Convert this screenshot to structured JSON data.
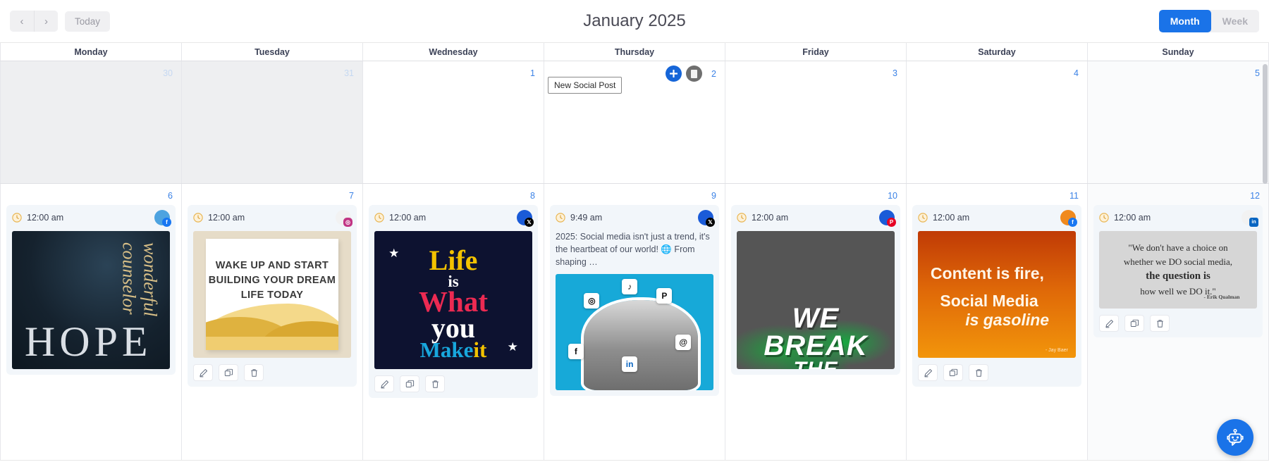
{
  "toolbar": {
    "prev_label": "‹",
    "next_label": "›",
    "today_label": "Today",
    "title": "January 2025",
    "month_label": "Month",
    "week_label": "Week"
  },
  "weekdays": [
    "Monday",
    "Tuesday",
    "Wednesday",
    "Thursday",
    "Friday",
    "Saturday",
    "Sunday"
  ],
  "tooltip": {
    "text": "New Social Post"
  },
  "colors": {
    "accent": "#1a73e8",
    "daynum": "#3b82e6",
    "daynum_muted": "#c5d8f2",
    "event_bg": "#f2f6fa",
    "other_month_bg": "#eeeff1"
  },
  "week1": [
    {
      "daynum": "30",
      "muted": true,
      "other_month": true
    },
    {
      "daynum": "31",
      "muted": true,
      "other_month": true
    },
    {
      "daynum": "1",
      "muted": false,
      "other_month": false
    },
    {
      "daynum": "2",
      "muted": false,
      "other_month": false,
      "hover": true
    },
    {
      "daynum": "3",
      "muted": false,
      "other_month": false
    },
    {
      "daynum": "4",
      "muted": false,
      "other_month": false
    },
    {
      "daynum": "5",
      "muted": false,
      "other_month": false,
      "weekend": true
    }
  ],
  "week2": [
    {
      "daynum": "6",
      "time": "12:00 am",
      "platform": "facebook",
      "avatar_color": "#4da3e0",
      "badge_glyph": "f",
      "badge_color": "#1877f2",
      "text": "",
      "art": "hope",
      "art_title": "HOPE",
      "art_script": "wonderful counselor",
      "show_actions": false
    },
    {
      "daynum": "7",
      "time": "12:00 am",
      "platform": "instagram",
      "avatar_color": "#f2f2f2",
      "badge_glyph": "◎",
      "badge_color": "#c13584",
      "text": "",
      "art": "wake",
      "art_text": "WAKE UP AND START BUILDING YOUR DREAM LIFE TODAY",
      "show_actions": true
    },
    {
      "daynum": "8",
      "time": "12:00 am",
      "platform": "twitter-x",
      "avatar_color": "#1a5bd8",
      "badge_glyph": "𝕏",
      "badge_color": "#000000",
      "text": "",
      "art": "life",
      "art_lines": [
        "Life",
        "is",
        "What",
        "you",
        "Make",
        "it"
      ],
      "show_actions": true
    },
    {
      "daynum": "9",
      "time": "9:49 am",
      "platform": "twitter-x",
      "avatar_color": "#1a5bd8",
      "badge_glyph": "𝕏",
      "badge_color": "#000000",
      "text": "2025: Social media isn't just a trend, it's the heartbeat of our world! 🌐 From shaping …",
      "art": "social",
      "art_icons": [
        "TikTok",
        "Pinterest",
        "Instagram",
        "Threads",
        "Facebook",
        "LinkedIn"
      ],
      "show_actions": false
    },
    {
      "daynum": "10",
      "time": "12:00 am",
      "platform": "pinterest",
      "avatar_color": "#1a5bd8",
      "badge_glyph": "P",
      "badge_color": "#e60023",
      "text": "",
      "art": "break",
      "art_lines": [
        "WE",
        "BREAK",
        "THE"
      ],
      "show_actions": false
    },
    {
      "daynum": "11",
      "time": "12:00 am",
      "platform": "facebook",
      "avatar_color": "#f08a1e",
      "badge_glyph": "f",
      "badge_color": "#1877f2",
      "text": "",
      "art": "fire",
      "art_line1": "Content is fire,",
      "art_line2": "Social Media",
      "art_line3": "is gasoline",
      "art_credit": "- Jay Baer",
      "show_actions": true
    },
    {
      "daynum": "12",
      "time": "12:00 am",
      "platform": "linkedin",
      "avatar_color": "#f2f2f2",
      "badge_glyph": "in",
      "badge_color": "#0a66c2",
      "text": "",
      "art": "qualman",
      "art_quote_1": "\"We don't have a choice on",
      "art_quote_2": "whether we DO social media,",
      "art_quote_3": "the question is",
      "art_quote_4": "how well we DO it.\"",
      "art_credit": "- Erik Qualman",
      "show_actions": true,
      "weekend": true
    }
  ],
  "actions": {
    "edit": "edit-icon",
    "duplicate": "duplicate-icon",
    "delete": "delete-icon"
  },
  "fab": {
    "name": "chatbot-icon"
  }
}
